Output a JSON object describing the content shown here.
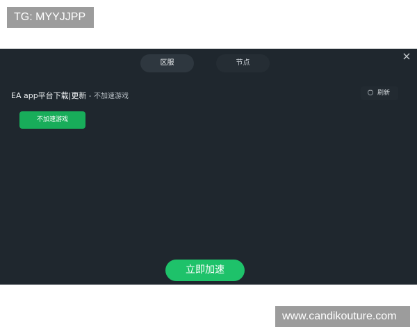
{
  "watermarks": {
    "top": "TG: MYYJJPP",
    "bottom": "www.candikouture.com"
  },
  "dialog": {
    "close_icon": "close-icon",
    "tabs": [
      {
        "label": "区服",
        "active": true
      },
      {
        "label": "节点",
        "active": false
      }
    ],
    "game": {
      "name": "EA app平台下载|更新",
      "separator": "-",
      "status": "不加速游戏"
    },
    "refresh": {
      "icon": "spinner-icon",
      "label": "刷新"
    },
    "no_accelerate_button": "不加速游戏",
    "accelerate_button": "立即加速"
  },
  "colors": {
    "panel_bg": "#1f272e",
    "accent_green": "#1ec26a",
    "watermark_bg": "#9c9c9c"
  }
}
